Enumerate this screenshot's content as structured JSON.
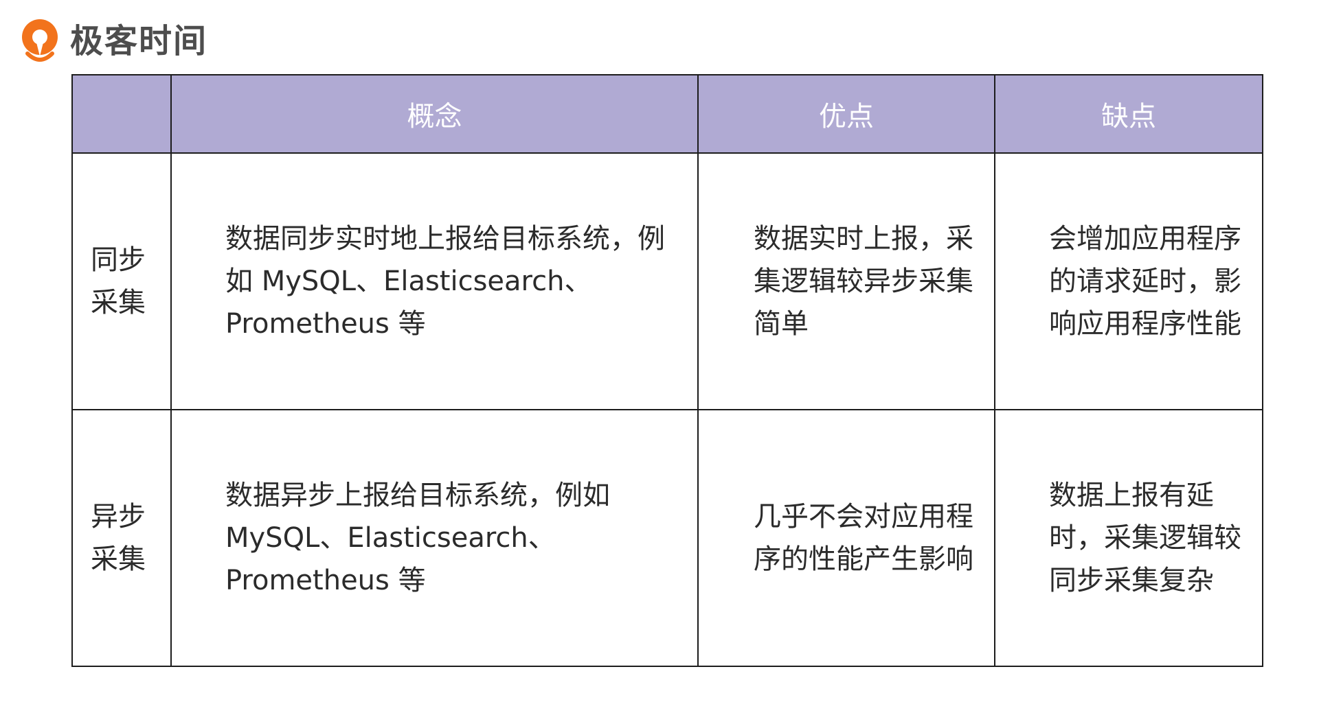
{
  "brand": {
    "name": "极客时间",
    "logo_icon": "geektime-logo-icon",
    "accent_color": "#f2731c"
  },
  "table": {
    "header_color": "#b0aad3",
    "headers": [
      "",
      "概念",
      "优点",
      "缺点"
    ],
    "rows": [
      {
        "label": "同步采集",
        "concept": "数据同步实时地上报给目标系统，例如 MySQL、Elasticsearch、Prometheus 等",
        "pros": "数据实时上报，采集逻辑较异步采集简单",
        "cons": "会增加应用程序的请求延时，影响应用程序性能"
      },
      {
        "label": "异步采集",
        "concept": "数据异步上报给目标系统，例如 MySQL、Elasticsearch、Prometheus 等",
        "pros": "几乎不会对应用程序的性能产生影响",
        "cons": "数据上报有延时，采集逻辑较同步采集复杂"
      }
    ]
  }
}
